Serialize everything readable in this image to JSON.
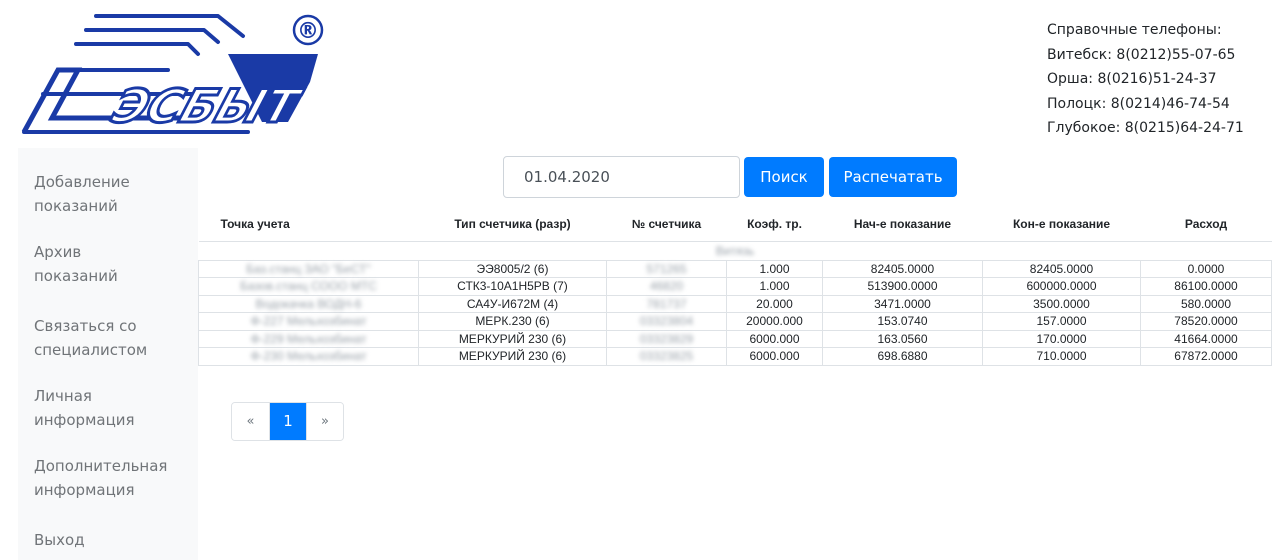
{
  "brand": {
    "logo_text": "ЭСБЫТ",
    "registered_mark": "®",
    "color": "#1a3aa6"
  },
  "contacts": {
    "title": "Справочные телефоны:",
    "lines": [
      "Витебск: 8(0212)55-07-65",
      "Орша: 8(0216)51-24-37",
      "Полоцк: 8(0214)46-74-54",
      "Глубокое: 8(0215)64-24-71"
    ]
  },
  "sidebar": {
    "items": [
      {
        "line1": "Добавление",
        "line2": "показаний"
      },
      {
        "line1": "Архив",
        "line2": "показаний"
      },
      {
        "line1": "Связаться со",
        "line2": "специалистом"
      },
      {
        "line1": "Личная",
        "line2": "информация"
      },
      {
        "line1": "Дополнительная",
        "line2": "информация"
      },
      {
        "line1": "Выход",
        "line2": ""
      }
    ]
  },
  "toolbar": {
    "date_value": "01.04.2020",
    "search_label": "Поиск",
    "print_label": "Распечатать"
  },
  "table": {
    "headers": [
      "Точка учета",
      "Тип счетчика (разр)",
      "№ счетчика",
      "Коэф. тр.",
      "Нач-е показание",
      "Кон-е показание",
      "Расход"
    ],
    "group": "Витязь",
    "rows": [
      {
        "point": "Баз.станц ЗАО \"БеСТ\"",
        "type": "ЭЭ8005/2 (6)",
        "number": "571265",
        "coef": "1.000",
        "start": "82405.0000",
        "end": "82405.0000",
        "usage": "0.0000"
      },
      {
        "point": "Базов.станц СООО МТС",
        "type": "СТК3-10А1Н5РВ (7)",
        "number": "46820",
        "coef": "1.000",
        "start": "513900.0000",
        "end": "600000.0000",
        "usage": "86100.0000"
      },
      {
        "point": "Водокачка ВОДН-6",
        "type": "СА4У-И672М (4)",
        "number": "781737",
        "coef": "20.000",
        "start": "3471.0000",
        "end": "3500.0000",
        "usage": "580.0000"
      },
      {
        "point": "Ф-227 Мельхозбинат",
        "type": "МЕРК.230 (6)",
        "number": "03323804",
        "coef": "20000.000",
        "start": "153.0740",
        "end": "157.0000",
        "usage": "78520.0000"
      },
      {
        "point": "Ф-229 Мельхозбинат",
        "type": "МЕРКУРИЙ 230 (6)",
        "number": "03323829",
        "coef": "6000.000",
        "start": "163.0560",
        "end": "170.0000",
        "usage": "41664.0000"
      },
      {
        "point": "Ф-230 Мельхозбинат",
        "type": "МЕРКУРИЙ 230 (6)",
        "number": "03323825",
        "coef": "6000.000",
        "start": "698.6880",
        "end": "710.0000",
        "usage": "67872.0000"
      }
    ]
  },
  "pagination": {
    "prev": "«",
    "current": "1",
    "next": "»",
    "accent": "#007bff"
  }
}
